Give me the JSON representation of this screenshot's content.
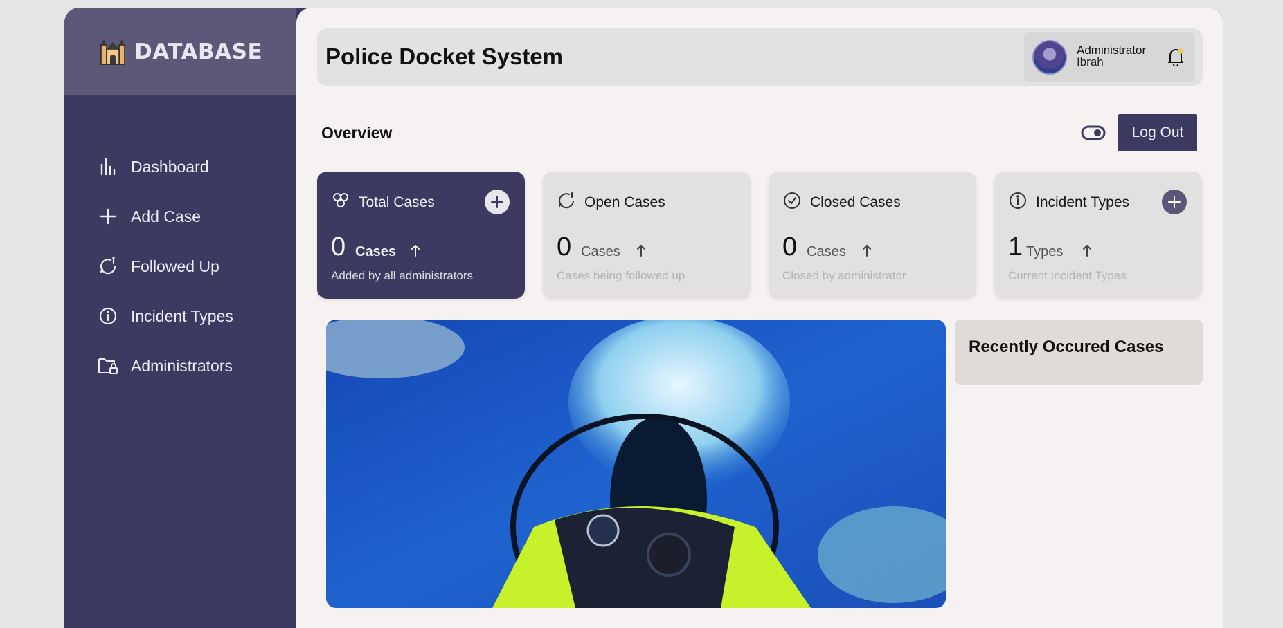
{
  "brand": {
    "name": "DATABASE",
    "icon": "castle-icon"
  },
  "sidebar": {
    "items": [
      {
        "label": "Dashboard",
        "icon": "bar-chart-icon"
      },
      {
        "label": "Add Case",
        "icon": "plus-icon"
      },
      {
        "label": "Followed Up",
        "icon": "follow-up-icon"
      },
      {
        "label": "Incident Types",
        "icon": "info-icon"
      },
      {
        "label": "Administrators",
        "icon": "folder-lock-icon"
      }
    ]
  },
  "header": {
    "title": "Police Docket System",
    "user_role": "Administrator",
    "user_name": "Ibrah",
    "notification_dot_color": "#f2c94c"
  },
  "overview": {
    "title": "Overview",
    "logout_label": "Log Out"
  },
  "cards": [
    {
      "title": "Total Cases",
      "value": "0",
      "unit": "Cases",
      "desc": "Added by all administrators",
      "icon": "hexagons-icon"
    },
    {
      "title": "Open Cases",
      "value": "0",
      "unit": "Cases",
      "desc": "Cases being followed up",
      "icon": "follow-up-icon"
    },
    {
      "title": "Closed Cases",
      "value": "0",
      "unit": "Cases",
      "desc": "Closed by administrator",
      "icon": "check-circle-icon"
    },
    {
      "title": "Incident Types",
      "value": "1",
      "unit": "Types",
      "desc": "Current Incident Types",
      "icon": "info-icon"
    }
  ],
  "recent": {
    "title": "Recently Occured Cases"
  },
  "colors": {
    "accent": "#3c3a61",
    "main_bg": "#f6f2f2"
  }
}
